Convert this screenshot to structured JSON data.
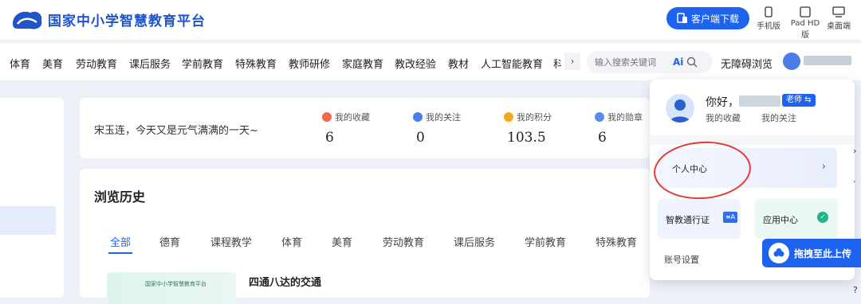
{
  "header": {
    "title": "国家中小学智慧教育平台",
    "download_label": "客户端下载",
    "devices": [
      "手机版",
      "Pad HD版",
      "桌面端"
    ]
  },
  "nav": {
    "items": [
      "体育",
      "美育",
      "劳动教育",
      "课后服务",
      "学前教育",
      "特殊教育",
      "教师研修",
      "家庭教育",
      "教改经验",
      "教材",
      "人工智能教育",
      "科"
    ],
    "more": "›",
    "search_placeholder": "输入搜索关键词",
    "ai_label": "Ai",
    "accessibility": "无障碍浏览"
  },
  "greeting": {
    "text": "宋玉连，今天又是元气满满的一天~",
    "stats": [
      {
        "label": "我的收藏",
        "value": "6",
        "icon": "heart-icon",
        "color": "#f06a4a"
      },
      {
        "label": "我的关注",
        "value": "0",
        "icon": "person-icon",
        "color": "#4a7de8"
      },
      {
        "label": "我的积分",
        "value": "103.5",
        "icon": "coin-icon",
        "color": "#f5a623"
      },
      {
        "label": "我的勋章",
        "value": "6",
        "icon": "medal-icon",
        "color": "#5b8def"
      }
    ]
  },
  "history": {
    "title": "浏览历史",
    "tabs": [
      "全部",
      "德育",
      "课程教学",
      "体育",
      "美育",
      "劳动教育",
      "课后服务",
      "学前教育",
      "特殊教育"
    ],
    "item_title": "四通八达的交通",
    "thumb_text": "国家中小学智慧教育平台"
  },
  "dropdown": {
    "hello": "你好，",
    "badge": "老师 ⇆",
    "links": [
      "我的收藏",
      "我的关注"
    ],
    "personal_center": "个人中心",
    "arrow": "›",
    "card1": "智教通行证",
    "card2": "应用中心",
    "account": "账号设置"
  },
  "upload": {
    "label": "拖拽至此上传"
  },
  "colors": {
    "brand": "#1f55c8",
    "accent": "#1e62f0",
    "annotation": "#e53935"
  }
}
